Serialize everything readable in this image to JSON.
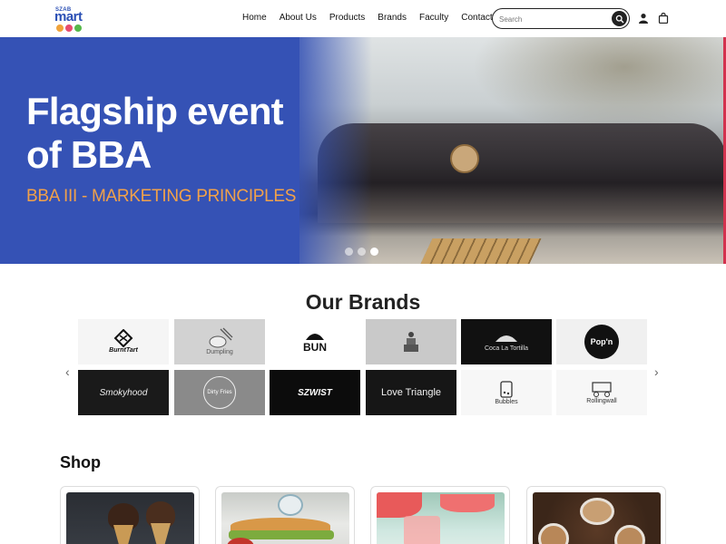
{
  "brand": {
    "logo_top": "SZAB",
    "logo_main": "mart"
  },
  "nav": {
    "links": [
      "Home",
      "About Us",
      "Products",
      "Brands",
      "Faculty",
      "Contact"
    ]
  },
  "search": {
    "placeholder": "Search"
  },
  "hero": {
    "title": "Flagship event of BBA",
    "subtitle": "BBA III - MARKETING PRINCIPLES",
    "slide_count": 3,
    "active_slide": 3
  },
  "brands_section": {
    "title": "Our Brands",
    "row1": [
      "BurntTart",
      "Dumpling",
      "BUN",
      "",
      "Coca La Tortilla",
      "Pop'n"
    ],
    "row2": [
      "Smokyhood",
      "Dirty Fries",
      "SZWIST",
      "Love Triangle",
      "Bubbles",
      "Rollingwall"
    ]
  },
  "shop": {
    "title": "Shop"
  },
  "colors": {
    "hero_blue": "#3552b5",
    "accent_orange": "#f1a14a",
    "accent_red": "#d3314e"
  }
}
